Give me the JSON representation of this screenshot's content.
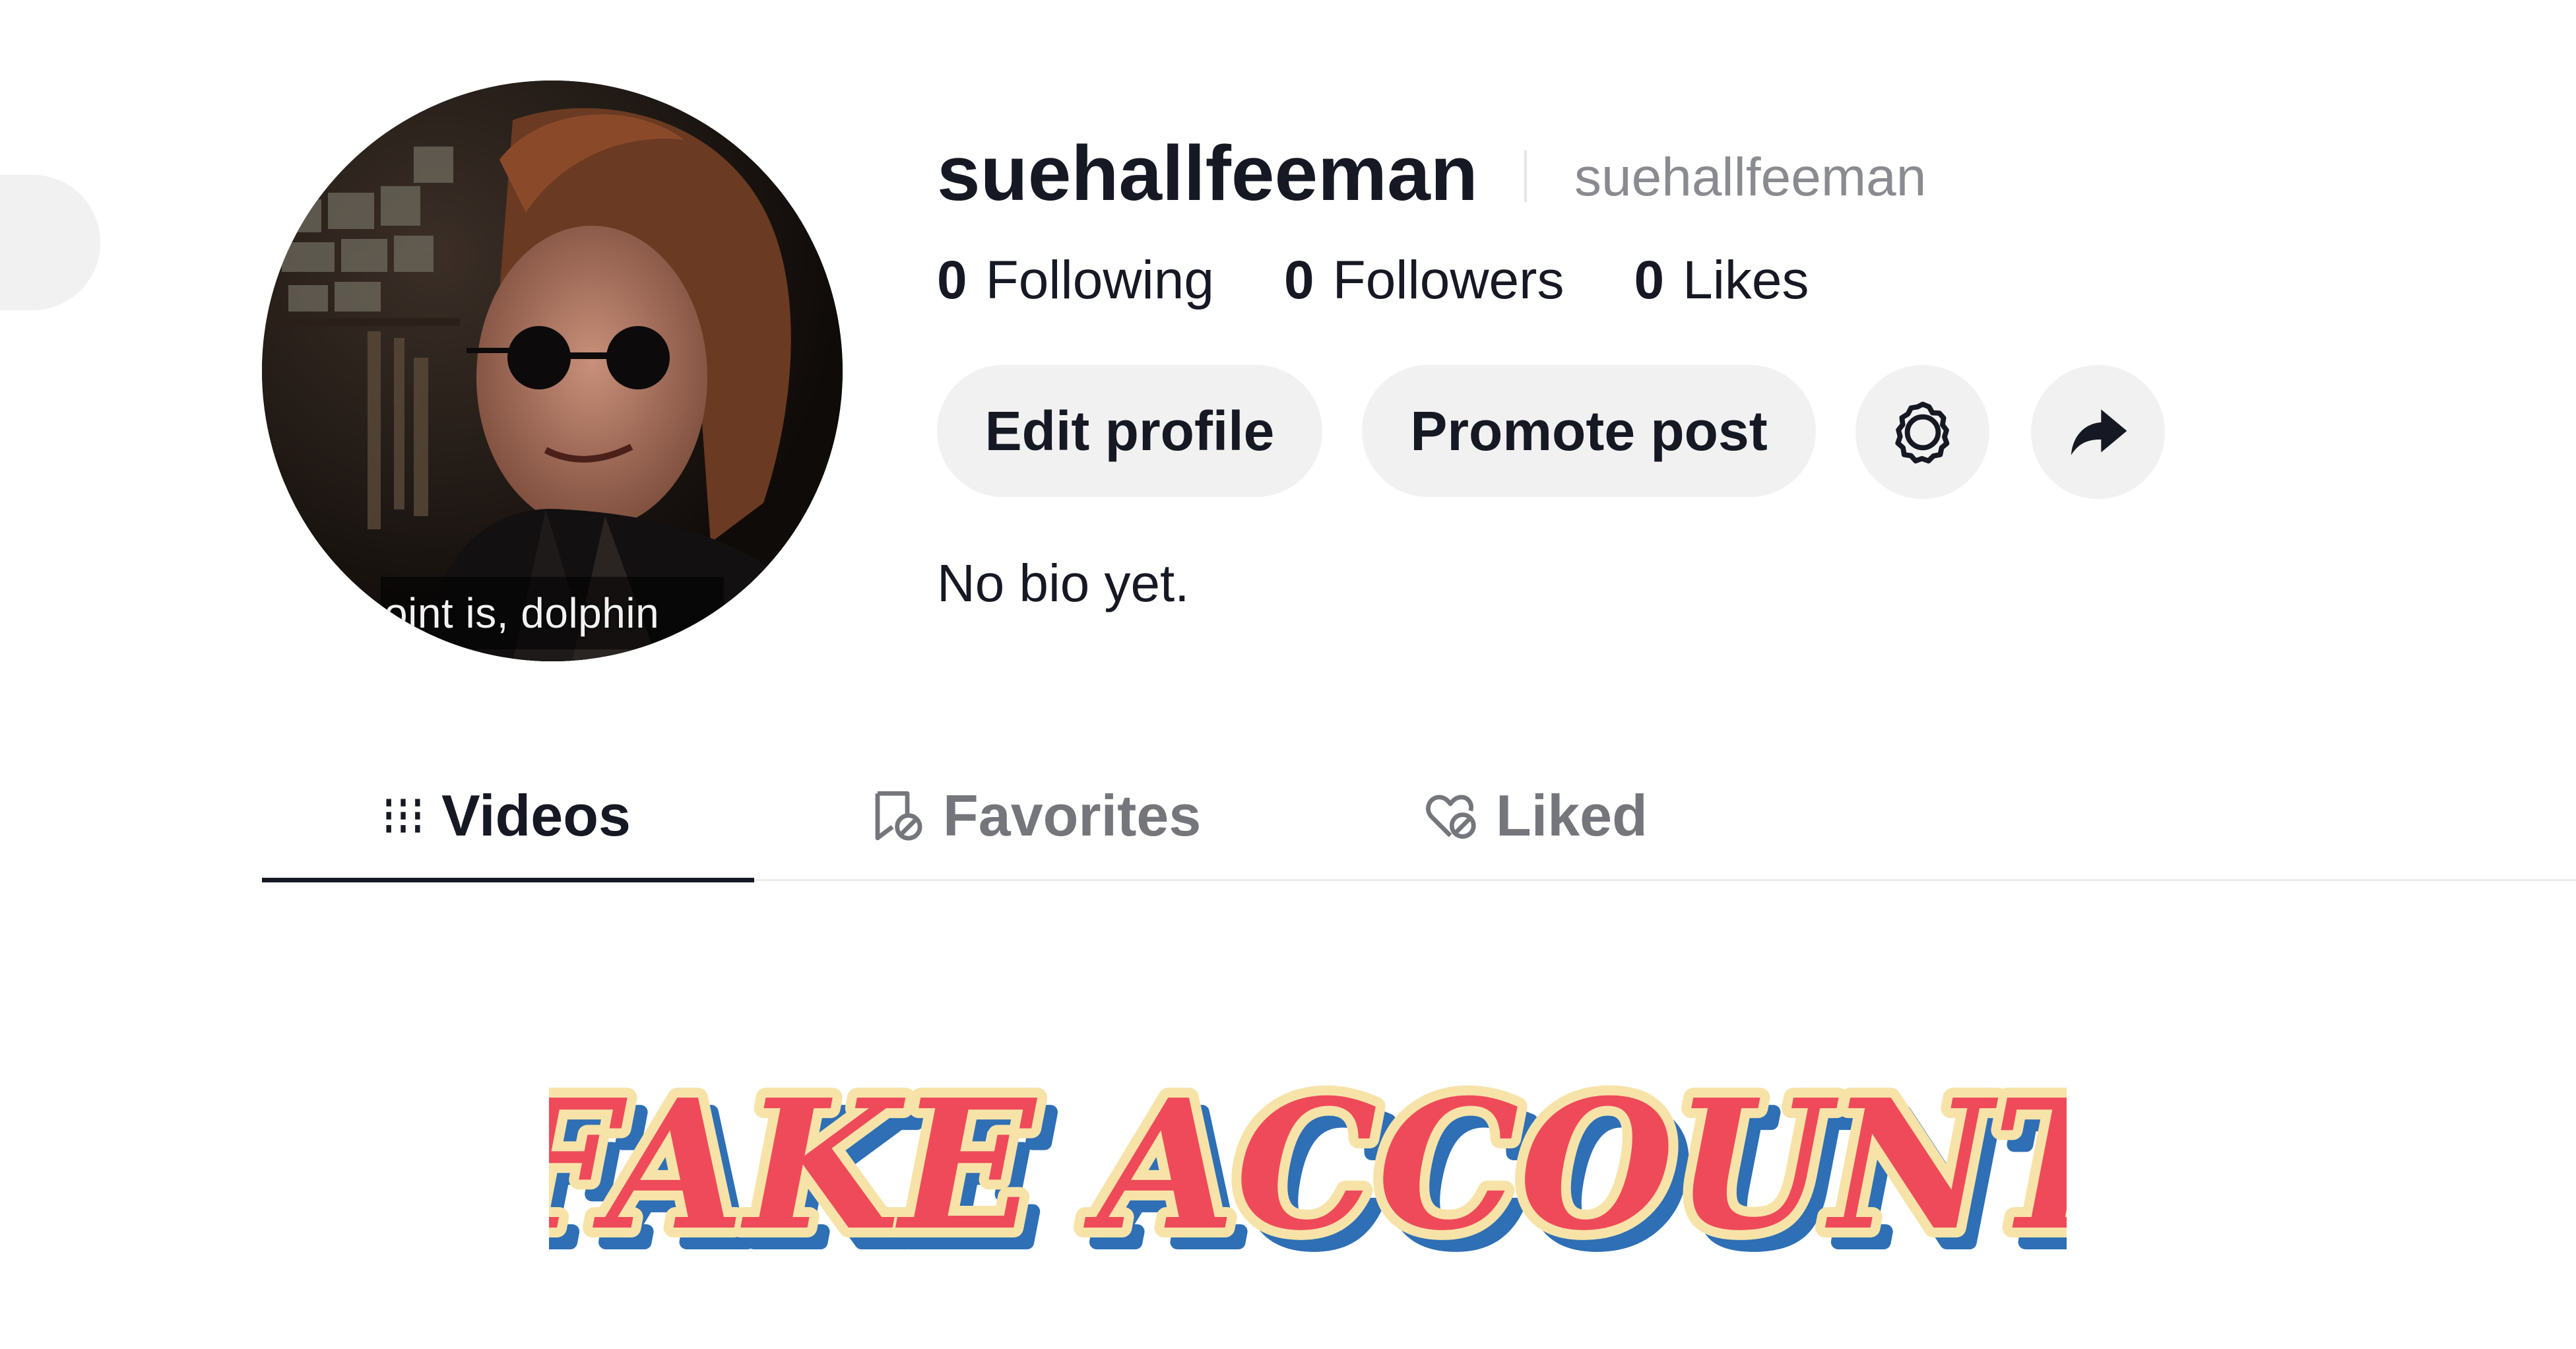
{
  "profile": {
    "username": "suehallfeeman",
    "nickname": "suehallfeeman",
    "avatar_caption": "oint is, dolphin",
    "bio": "No bio yet."
  },
  "stats": [
    {
      "count": "0",
      "label": "Following"
    },
    {
      "count": "0",
      "label": "Followers"
    },
    {
      "count": "0",
      "label": "Likes"
    }
  ],
  "actions": {
    "edit_label": "Edit profile",
    "promote_label": "Promote post",
    "settings_icon": "gear-icon",
    "share_icon": "share-arrow-icon"
  },
  "tabs": [
    {
      "label": "Videos",
      "icon": "grid-icon",
      "active": true
    },
    {
      "label": "Favorites",
      "icon": "bookmark-icon",
      "active": false
    },
    {
      "label": "Liked",
      "icon": "heart-icon",
      "active": false
    }
  ],
  "overlay": {
    "text": "FAKE ACCOUNT",
    "fill_color": "#ef4a5a",
    "outline_color": "#f7e3a8",
    "shadow_color": "#2e6fb5"
  },
  "colors": {
    "button_bg": "#f1f1f2",
    "text_primary": "#161823",
    "text_secondary": "#75767c"
  }
}
